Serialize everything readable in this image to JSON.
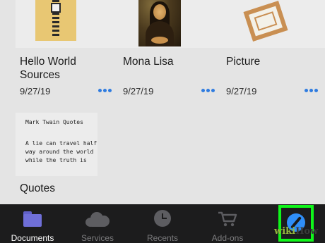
{
  "files": [
    {
      "title": "Hello World Sources",
      "date": "9/27/19",
      "thumbnail": "zip-archive-icon"
    },
    {
      "title": "Mona Lisa",
      "date": "9/27/19",
      "thumbnail": "mona-lisa-painting"
    },
    {
      "title": "Picture",
      "date": "9/27/19",
      "thumbnail": "picture-frame-icon"
    }
  ],
  "document": {
    "preview_title": "Mark Twain Quotes",
    "preview_body": "A lie can travel half way around the world while the truth is",
    "title": "Quotes"
  },
  "tabbar": {
    "tabs": [
      {
        "label": "Documents",
        "icon": "folder-icon",
        "active": true
      },
      {
        "label": "Services",
        "icon": "cloud-icon",
        "active": false
      },
      {
        "label": "Recents",
        "icon": "clock-icon",
        "active": false
      },
      {
        "label": "Add-ons",
        "icon": "cart-icon",
        "active": false
      },
      {
        "label": "",
        "icon": "compass-icon",
        "active": false
      }
    ]
  },
  "colors": {
    "accent": "#2f7ce0",
    "highlight": "#0ff61a",
    "tabbar_bg": "#1c1c1d",
    "active_folder": "#6f6fd8"
  },
  "watermark": {
    "part1": "wiki",
    "part2": "How"
  }
}
